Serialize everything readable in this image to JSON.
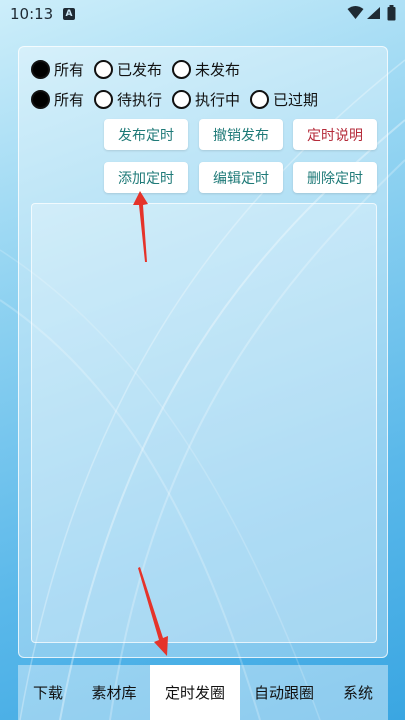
{
  "status_bar": {
    "time": "10:13",
    "notification_icon": "A"
  },
  "filters": {
    "publish_status": [
      {
        "label": "所有",
        "checked": true
      },
      {
        "label": "已发布",
        "checked": false
      },
      {
        "label": "未发布",
        "checked": false
      }
    ],
    "task_status": [
      {
        "label": "所有",
        "checked": true
      },
      {
        "label": "待执行",
        "checked": false
      },
      {
        "label": "执行中",
        "checked": false
      },
      {
        "label": "已过期",
        "checked": false
      }
    ]
  },
  "actions": {
    "publish_schedule": "发布定时",
    "revoke_publish": "撤销发布",
    "schedule_help": "定时说明",
    "add_schedule": "添加定时",
    "edit_schedule": "编辑定时",
    "delete_schedule": "删除定时"
  },
  "tabs": [
    {
      "label": "下载",
      "active": false
    },
    {
      "label": "素材库",
      "active": false
    },
    {
      "label": "定时发圈",
      "active": true
    },
    {
      "label": "自动跟圈",
      "active": false
    },
    {
      "label": "系统",
      "active": false
    }
  ],
  "colors": {
    "teal_text": "#1f7a78",
    "danger_text": "#b52b3a",
    "annotation_arrow": "#e5332a"
  }
}
